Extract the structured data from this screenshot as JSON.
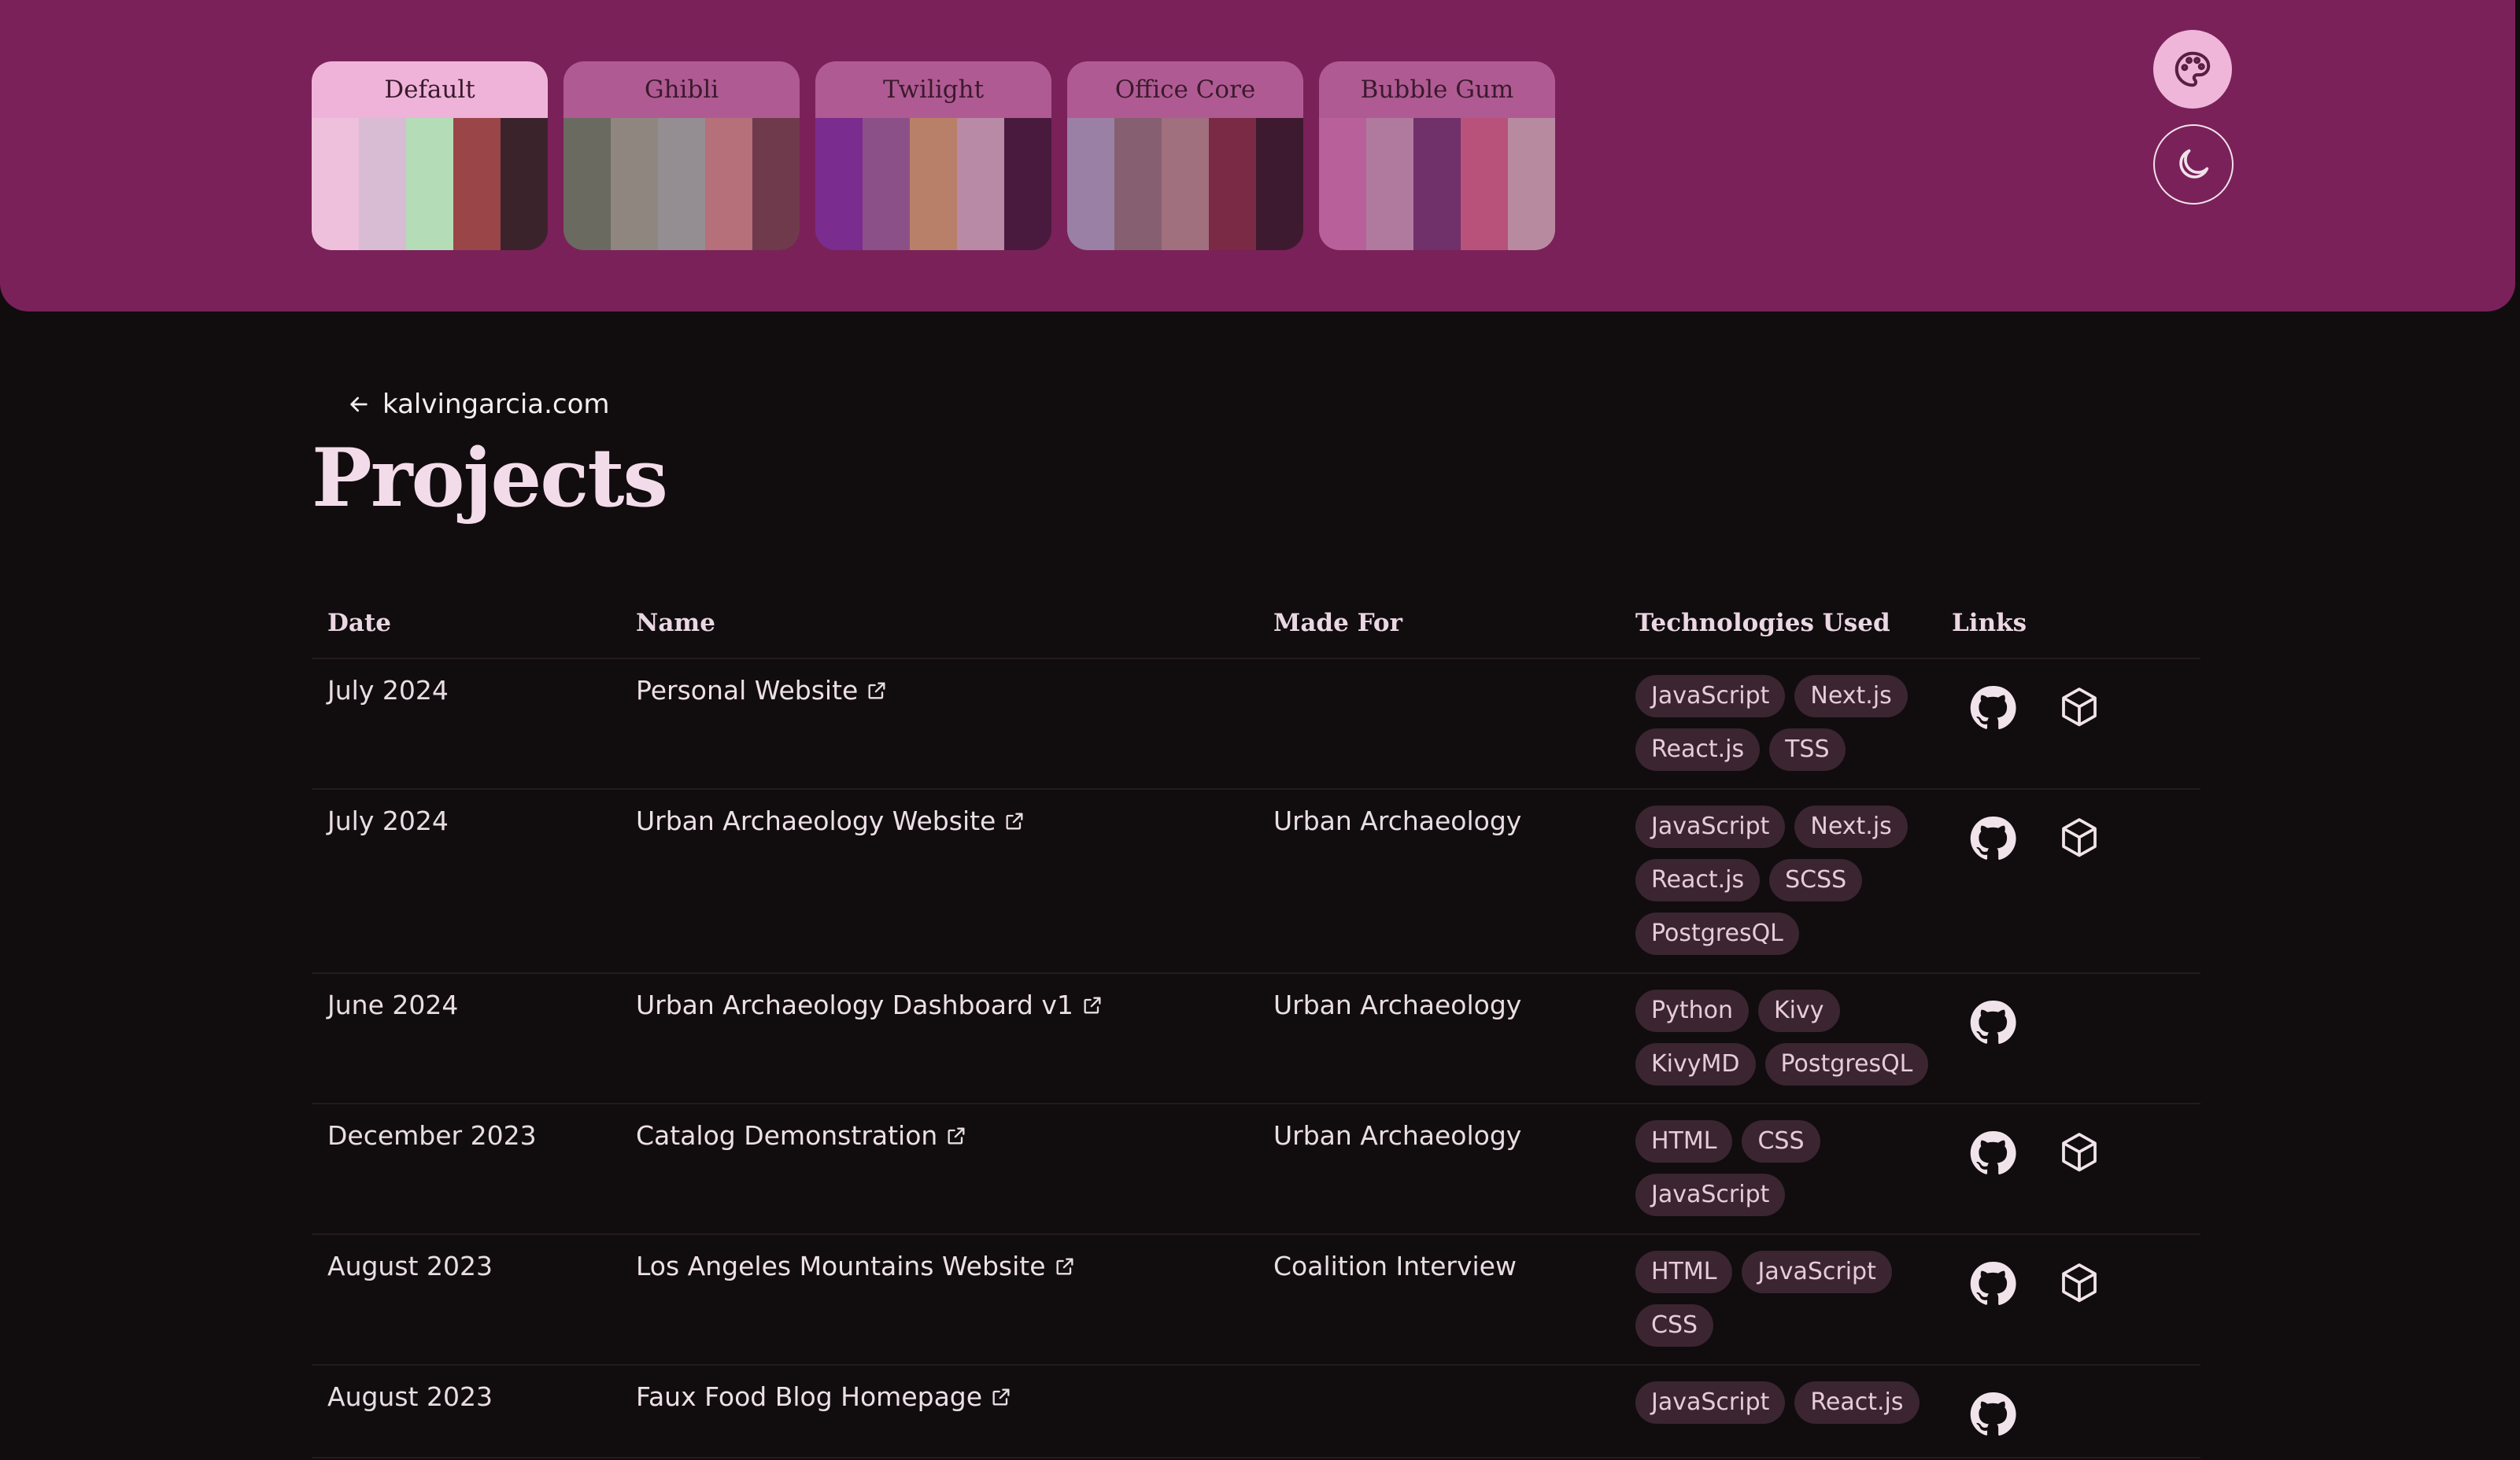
{
  "themes": [
    {
      "label": "Default",
      "header_bg": "#efb3d9",
      "label_color": "#3a1a2e",
      "stripes": [
        "#eec0dc",
        "#d7bcd3",
        "#b4dcb7",
        "#9a4548",
        "#3b232c"
      ]
    },
    {
      "label": "Ghibli",
      "header_bg": "#b05a93",
      "label_color": "#3a1a2e",
      "stripes": [
        "#6a6a60",
        "#908680",
        "#948e92",
        "#b5707a",
        "#6e3a4c"
      ]
    },
    {
      "label": "Twilight",
      "header_bg": "#b05a93",
      "label_color": "#3a1a2e",
      "stripes": [
        "#7a2d8e",
        "#8c5088",
        "#b88068",
        "#b88aa5",
        "#4a1a3e"
      ]
    },
    {
      "label": "Office Core",
      "header_bg": "#b05a93",
      "label_color": "#3a1a2e",
      "stripes": [
        "#9a80a4",
        "#866070",
        "#a0707e",
        "#7a2a44",
        "#3e1a30"
      ]
    },
    {
      "label": "Bubble Gum",
      "header_bg": "#b05a93",
      "label_color": "#3a1a2e",
      "stripes": [
        "#b8609a",
        "#b07a9e",
        "#70306a",
        "#b8527a",
        "#b88aa0"
      ]
    }
  ],
  "back_link": {
    "label": "kalvingarcia.com"
  },
  "page_title": "Projects",
  "table": {
    "headers": {
      "date": "Date",
      "name": "Name",
      "made_for": "Made For",
      "tech": "Technologies Used",
      "links": "Links"
    },
    "rows": [
      {
        "date": "July 2024",
        "name": "Personal Website",
        "made_for": "",
        "tech": [
          "JavaScript",
          "Next.js",
          "React.js",
          "TSS"
        ],
        "github": true,
        "package": true
      },
      {
        "date": "July 2024",
        "name": "Urban Archaeology Website",
        "made_for": "Urban Archaeology",
        "tech": [
          "JavaScript",
          "Next.js",
          "React.js",
          "SCSS",
          "PostgresQL"
        ],
        "github": true,
        "package": true
      },
      {
        "date": "June 2024",
        "name": "Urban Archaeology Dashboard v1",
        "made_for": "Urban Archaeology",
        "tech": [
          "Python",
          "Kivy",
          "KivyMD",
          "PostgresQL"
        ],
        "github": true,
        "package": false
      },
      {
        "date": "December 2023",
        "name": "Catalog Demonstration",
        "made_for": "Urban Archaeology",
        "tech": [
          "HTML",
          "CSS",
          "JavaScript"
        ],
        "github": true,
        "package": true
      },
      {
        "date": "August 2023",
        "name": "Los Angeles Mountains Website",
        "made_for": "Coalition Interview",
        "tech": [
          "HTML",
          "JavaScript",
          "CSS"
        ],
        "github": true,
        "package": true
      },
      {
        "date": "August 2023",
        "name": "Faux Food Blog Homepage",
        "made_for": "",
        "tech": [
          "JavaScript",
          "React.js"
        ],
        "github": true,
        "package": false
      }
    ]
  },
  "colors": {
    "header_panel": "#7a215a",
    "page_bg": "#110c0e",
    "tag_bg": "#3a2530"
  },
  "icons": {
    "palette": "palette-icon",
    "theme_toggle": "moon-icon",
    "back": "arrow-left-icon",
    "external": "external-link-icon",
    "github": "github-icon",
    "package": "package-icon"
  }
}
